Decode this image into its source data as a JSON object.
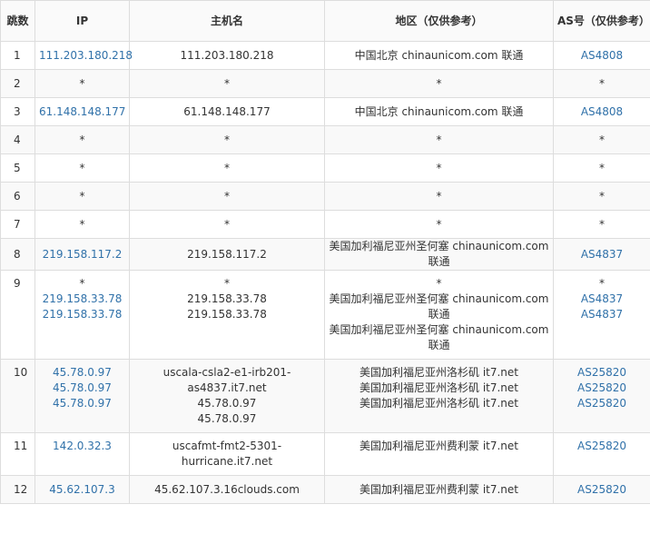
{
  "headers": {
    "hop": "跳数",
    "ip": "IP",
    "host": "主机名",
    "region": "地区（仅供参考）",
    "as": "AS号（仅供参考）"
  },
  "rows": [
    {
      "hop": "1",
      "ip": [
        "111.203.180.218"
      ],
      "host": [
        "111.203.180.218"
      ],
      "region": [
        "中国北京 chinaunicom.com 联通"
      ],
      "as": [
        "AS4808"
      ]
    },
    {
      "hop": "2",
      "ip": [
        "*"
      ],
      "host": [
        "*"
      ],
      "region": [
        "*"
      ],
      "as": [
        "*"
      ]
    },
    {
      "hop": "3",
      "ip": [
        "61.148.148.177"
      ],
      "host": [
        "61.148.148.177"
      ],
      "region": [
        "中国北京 chinaunicom.com 联通"
      ],
      "as": [
        "AS4808"
      ]
    },
    {
      "hop": "4",
      "ip": [
        "*"
      ],
      "host": [
        "*"
      ],
      "region": [
        "*"
      ],
      "as": [
        "*"
      ]
    },
    {
      "hop": "5",
      "ip": [
        "*"
      ],
      "host": [
        "*"
      ],
      "region": [
        "*"
      ],
      "as": [
        "*"
      ]
    },
    {
      "hop": "6",
      "ip": [
        "*"
      ],
      "host": [
        "*"
      ],
      "region": [
        "*"
      ],
      "as": [
        "*"
      ]
    },
    {
      "hop": "7",
      "ip": [
        "*"
      ],
      "host": [
        "*"
      ],
      "region": [
        "*"
      ],
      "as": [
        "*"
      ]
    },
    {
      "hop": "8",
      "ip": [
        "219.158.117.2"
      ],
      "host": [
        "219.158.117.2"
      ],
      "region": [
        "美国加利福尼亚州圣何塞 chinaunicom.com 联通"
      ],
      "as": [
        "AS4837"
      ]
    },
    {
      "hop": "9",
      "ip": [
        "*",
        "219.158.33.78",
        "219.158.33.78"
      ],
      "host": [
        "*",
        "219.158.33.78",
        "219.158.33.78"
      ],
      "region": [
        "*",
        "美国加利福尼亚州圣何塞 chinaunicom.com 联通",
        "美国加利福尼亚州圣何塞 chinaunicom.com 联通"
      ],
      "as": [
        "*",
        "AS4837",
        "AS4837"
      ]
    },
    {
      "hop": "10",
      "ip": [
        "45.78.0.97",
        "45.78.0.97",
        "45.78.0.97"
      ],
      "host": [
        "uscala-csla2-e1-irb201-as4837.it7.net",
        "45.78.0.97",
        "45.78.0.97"
      ],
      "region": [
        "美国加利福尼亚州洛杉矶 it7.net",
        "美国加利福尼亚州洛杉矶 it7.net",
        "美国加利福尼亚州洛杉矶 it7.net"
      ],
      "as": [
        "AS25820",
        "AS25820",
        "AS25820"
      ]
    },
    {
      "hop": "11",
      "ip": [
        "142.0.32.3"
      ],
      "host": [
        "uscafmt-fmt2-5301-hurricane.it7.net"
      ],
      "region": [
        "美国加利福尼亚州费利蒙 it7.net"
      ],
      "as": [
        "AS25820"
      ]
    },
    {
      "hop": "12",
      "ip": [
        "45.62.107.3"
      ],
      "host": [
        "45.62.107.3.16clouds.com"
      ],
      "region": [
        "美国加利福尼亚州费利蒙 it7.net"
      ],
      "as": [
        "AS25820"
      ]
    }
  ]
}
